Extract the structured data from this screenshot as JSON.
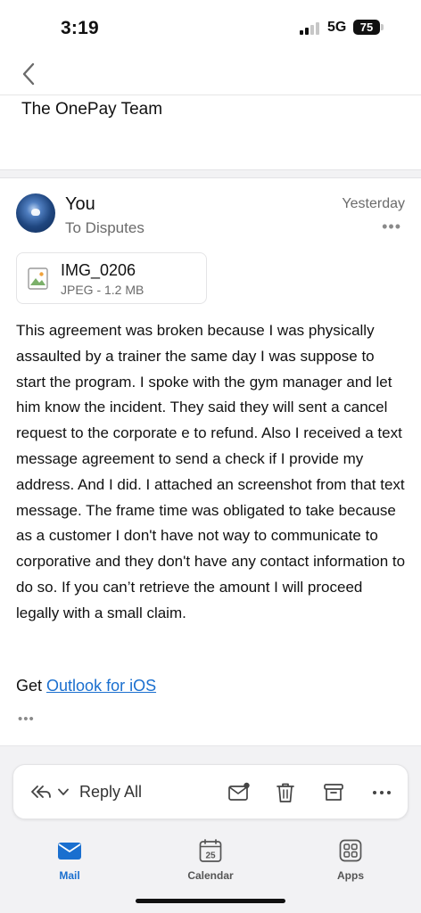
{
  "status_bar": {
    "time": "3:19",
    "network": "5G",
    "battery": "75"
  },
  "previous_message": {
    "signature_line": "The OnePay Team"
  },
  "message": {
    "sender": "You",
    "recipient_line": "To Disputes",
    "date": "Yesterday",
    "attachment": {
      "name": "IMG_0206",
      "meta": "JPEG - 1.2 MB"
    },
    "body": "This agreement was broken because I was physically assaulted by a trainer the same day I was suppose to start the program. I spoke with the gym manager and let him know the incident. They said they will sent a cancel request to the corporate e to refund. Also I received a text message agreement to send a check if I provide my address. And I did. I attached an screenshot from that text message. The frame time was obligated to take because as a customer I don't have not way to communicate to corporative and they don't have any contact information to do so. If you can’t retrieve the amount I will proceed legally with a small claim.",
    "signature_prefix": "Get",
    "signature_link": "Outlook for iOS"
  },
  "action_bar": {
    "reply_label": "Reply All"
  },
  "tabs": [
    {
      "label": "Mail",
      "icon": "mail-icon"
    },
    {
      "label": "Calendar",
      "icon": "calendar-icon",
      "day": "25"
    },
    {
      "label": "Apps",
      "icon": "apps-icon"
    }
  ],
  "colors": {
    "accent": "#1a6fcf"
  }
}
